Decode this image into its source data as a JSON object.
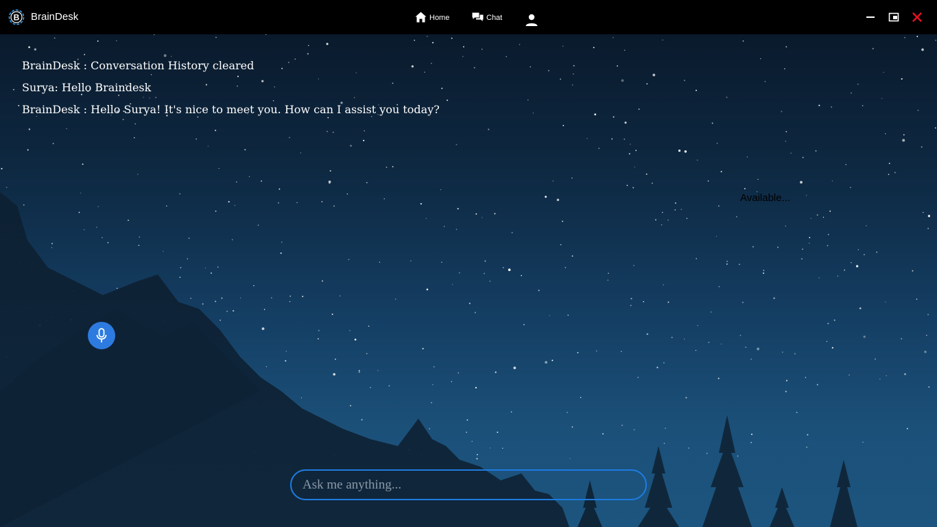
{
  "app": {
    "title": "BrainDesk",
    "logo_letter": "B",
    "accent": "#1e7be0"
  },
  "nav": {
    "home_label": "Home",
    "chat_label": "Chat",
    "home_icon": "home-icon",
    "chat_icon": "chat-icon",
    "user_icon": "user-icon"
  },
  "window_controls": {
    "minimize_icon": "minimize-icon",
    "restore_icon": "restore-icon",
    "close_icon": "close-icon",
    "close_color": "#e81123"
  },
  "chat": {
    "messages": [
      "BrainDesk : Conversation History cleared",
      "Surya: Hello Braindesk",
      "BrainDesk : Hello Surya! It's nice to meet you. How can I assist you today?"
    ]
  },
  "status": {
    "text": "Available..."
  },
  "mic": {
    "icon": "microphone-icon",
    "color": "#2d7be0"
  },
  "input": {
    "placeholder": "Ask me anything...",
    "value": ""
  }
}
